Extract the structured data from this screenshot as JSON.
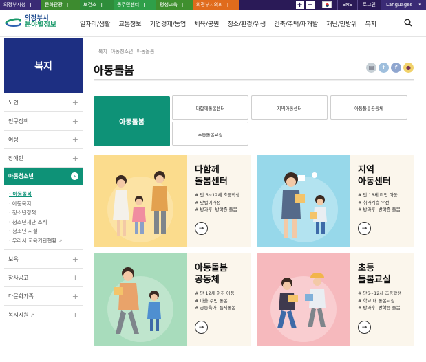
{
  "topbar": {
    "tabs": [
      "의정부시청",
      "문화관광",
      "보건소",
      "동주민센터",
      "평생교육",
      "의정부시의회"
    ],
    "zoom_in": "+",
    "zoom_out": "−",
    "sns": "SNS",
    "login": "로그인",
    "languages": "Languages"
  },
  "header": {
    "logo_line1": "의정부시",
    "logo_line2": "분야별정보",
    "menu": [
      "일자리/생활",
      "교통정보",
      "기업경제/농업",
      "체육/공원",
      "청소/환경/위생",
      "건축/주택/재개발",
      "재난/민방위",
      "복지"
    ]
  },
  "lnb": {
    "title": "복지",
    "items_before": [
      "노인",
      "인구정책",
      "여성",
      "장애인"
    ],
    "active": "아동청소년",
    "sub": [
      "아동돌봄",
      "아동복지",
      "청소년정책",
      "청소년재단 조직",
      "청소년 시설",
      "우리시 교육기관현황"
    ],
    "items_after": [
      "보육",
      "장사공고",
      "다문화가족",
      "복지지원"
    ]
  },
  "breadcrumb": "복지 아동청소년 아동돌봄",
  "page_title": "아동돌봄",
  "tabs": {
    "active": "아동돌봄",
    "buttons": [
      "다함께돌봄센터",
      "지역아동센터",
      "아동돌봄공동체",
      "초등돌봄교실"
    ]
  },
  "cards": [
    {
      "title": "다함께\n돌봄센터",
      "bullets": [
        "# 만 6~12세 초등학생",
        "# 맞벌이가정",
        "# 방과후, 방학중 돌봄"
      ]
    },
    {
      "title": "지역\n아동센터",
      "bullets": [
        "# 만 18세 미만 아동",
        "# 취약계층 우선",
        "# 방과후, 방학중 돌봄"
      ]
    },
    {
      "title": "아동돌봄\n공동체",
      "bullets": [
        "# 만 12세 이하 아동",
        "# 마을 주민 돌봄",
        "# 공동육아, 품세돌봄"
      ]
    },
    {
      "title": "초등\n돌봄교실",
      "bullets": [
        "# 만6~12세 초등학생",
        "# 학교 내 돌봄교실",
        "# 방과후, 방학중 돌봄"
      ]
    }
  ],
  "colors": {
    "brand_navy": "#1d2f82",
    "accent_green": "#0e9277",
    "topbar": "#2a1a57"
  },
  "icons": [
    "search-icon",
    "print-icon",
    "twitter-icon",
    "facebook-icon",
    "blog-icon",
    "arrow-right-icon"
  ]
}
